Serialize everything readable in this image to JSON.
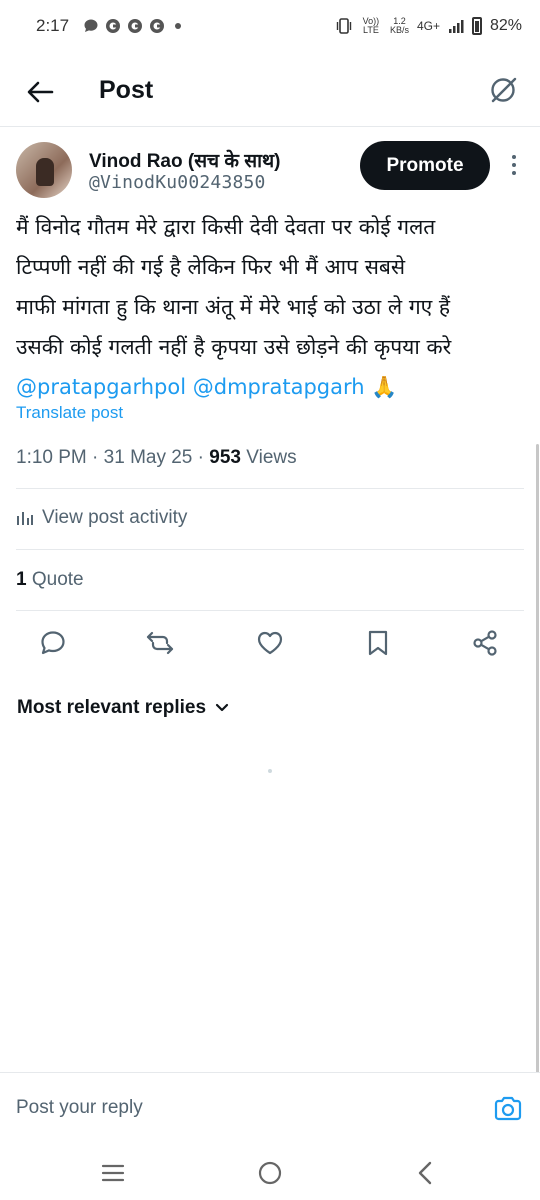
{
  "status_bar": {
    "time": "2:17",
    "network_speed_value": "1.2",
    "network_speed_unit": "KB/s",
    "network_type": "4G+",
    "volte": "Vo)) LTE",
    "battery": "82%"
  },
  "header": {
    "title": "Post",
    "back_icon": "arrow-left-icon",
    "grok_icon": "grok-icon"
  },
  "post": {
    "author_name": "Vinod Rao (सच के साथ)",
    "author_handle": "@VinodKu00243850",
    "promote_label": "Promote",
    "text_lines": [
      "मैं विनोद गौतम मेरे द्वारा किसी देवी देवता पर कोई गलत",
      "टिप्पणी नहीं की गई है  लेकिन फिर भी मैं आप सबसे",
      "माफी मांगता हु कि थाना अंतू में मेरे भाई को उठा ले गए हैं",
      "उसकी कोई गलती नहीं है कृपया उसे छोड़ने की कृपया करे"
    ],
    "mentions": [
      "@pratapgarhpol",
      "@dmpratapgarh"
    ],
    "emoji": "🙏",
    "translate_label": "Translate post",
    "time": "1:10 PM",
    "date": "31 May 25",
    "views_count": "953",
    "views_label": "Views",
    "activity_label": "View post activity",
    "quote_count": "1",
    "quote_label": "Quote"
  },
  "actions": [
    "reply-icon",
    "repost-icon",
    "like-icon",
    "bookmark-icon",
    "share-icon"
  ],
  "replies": {
    "sort_label": "Most relevant replies"
  },
  "reply_bar": {
    "placeholder": "Post your reply"
  },
  "nav": [
    "recents-icon",
    "home-icon",
    "back-icon"
  ]
}
